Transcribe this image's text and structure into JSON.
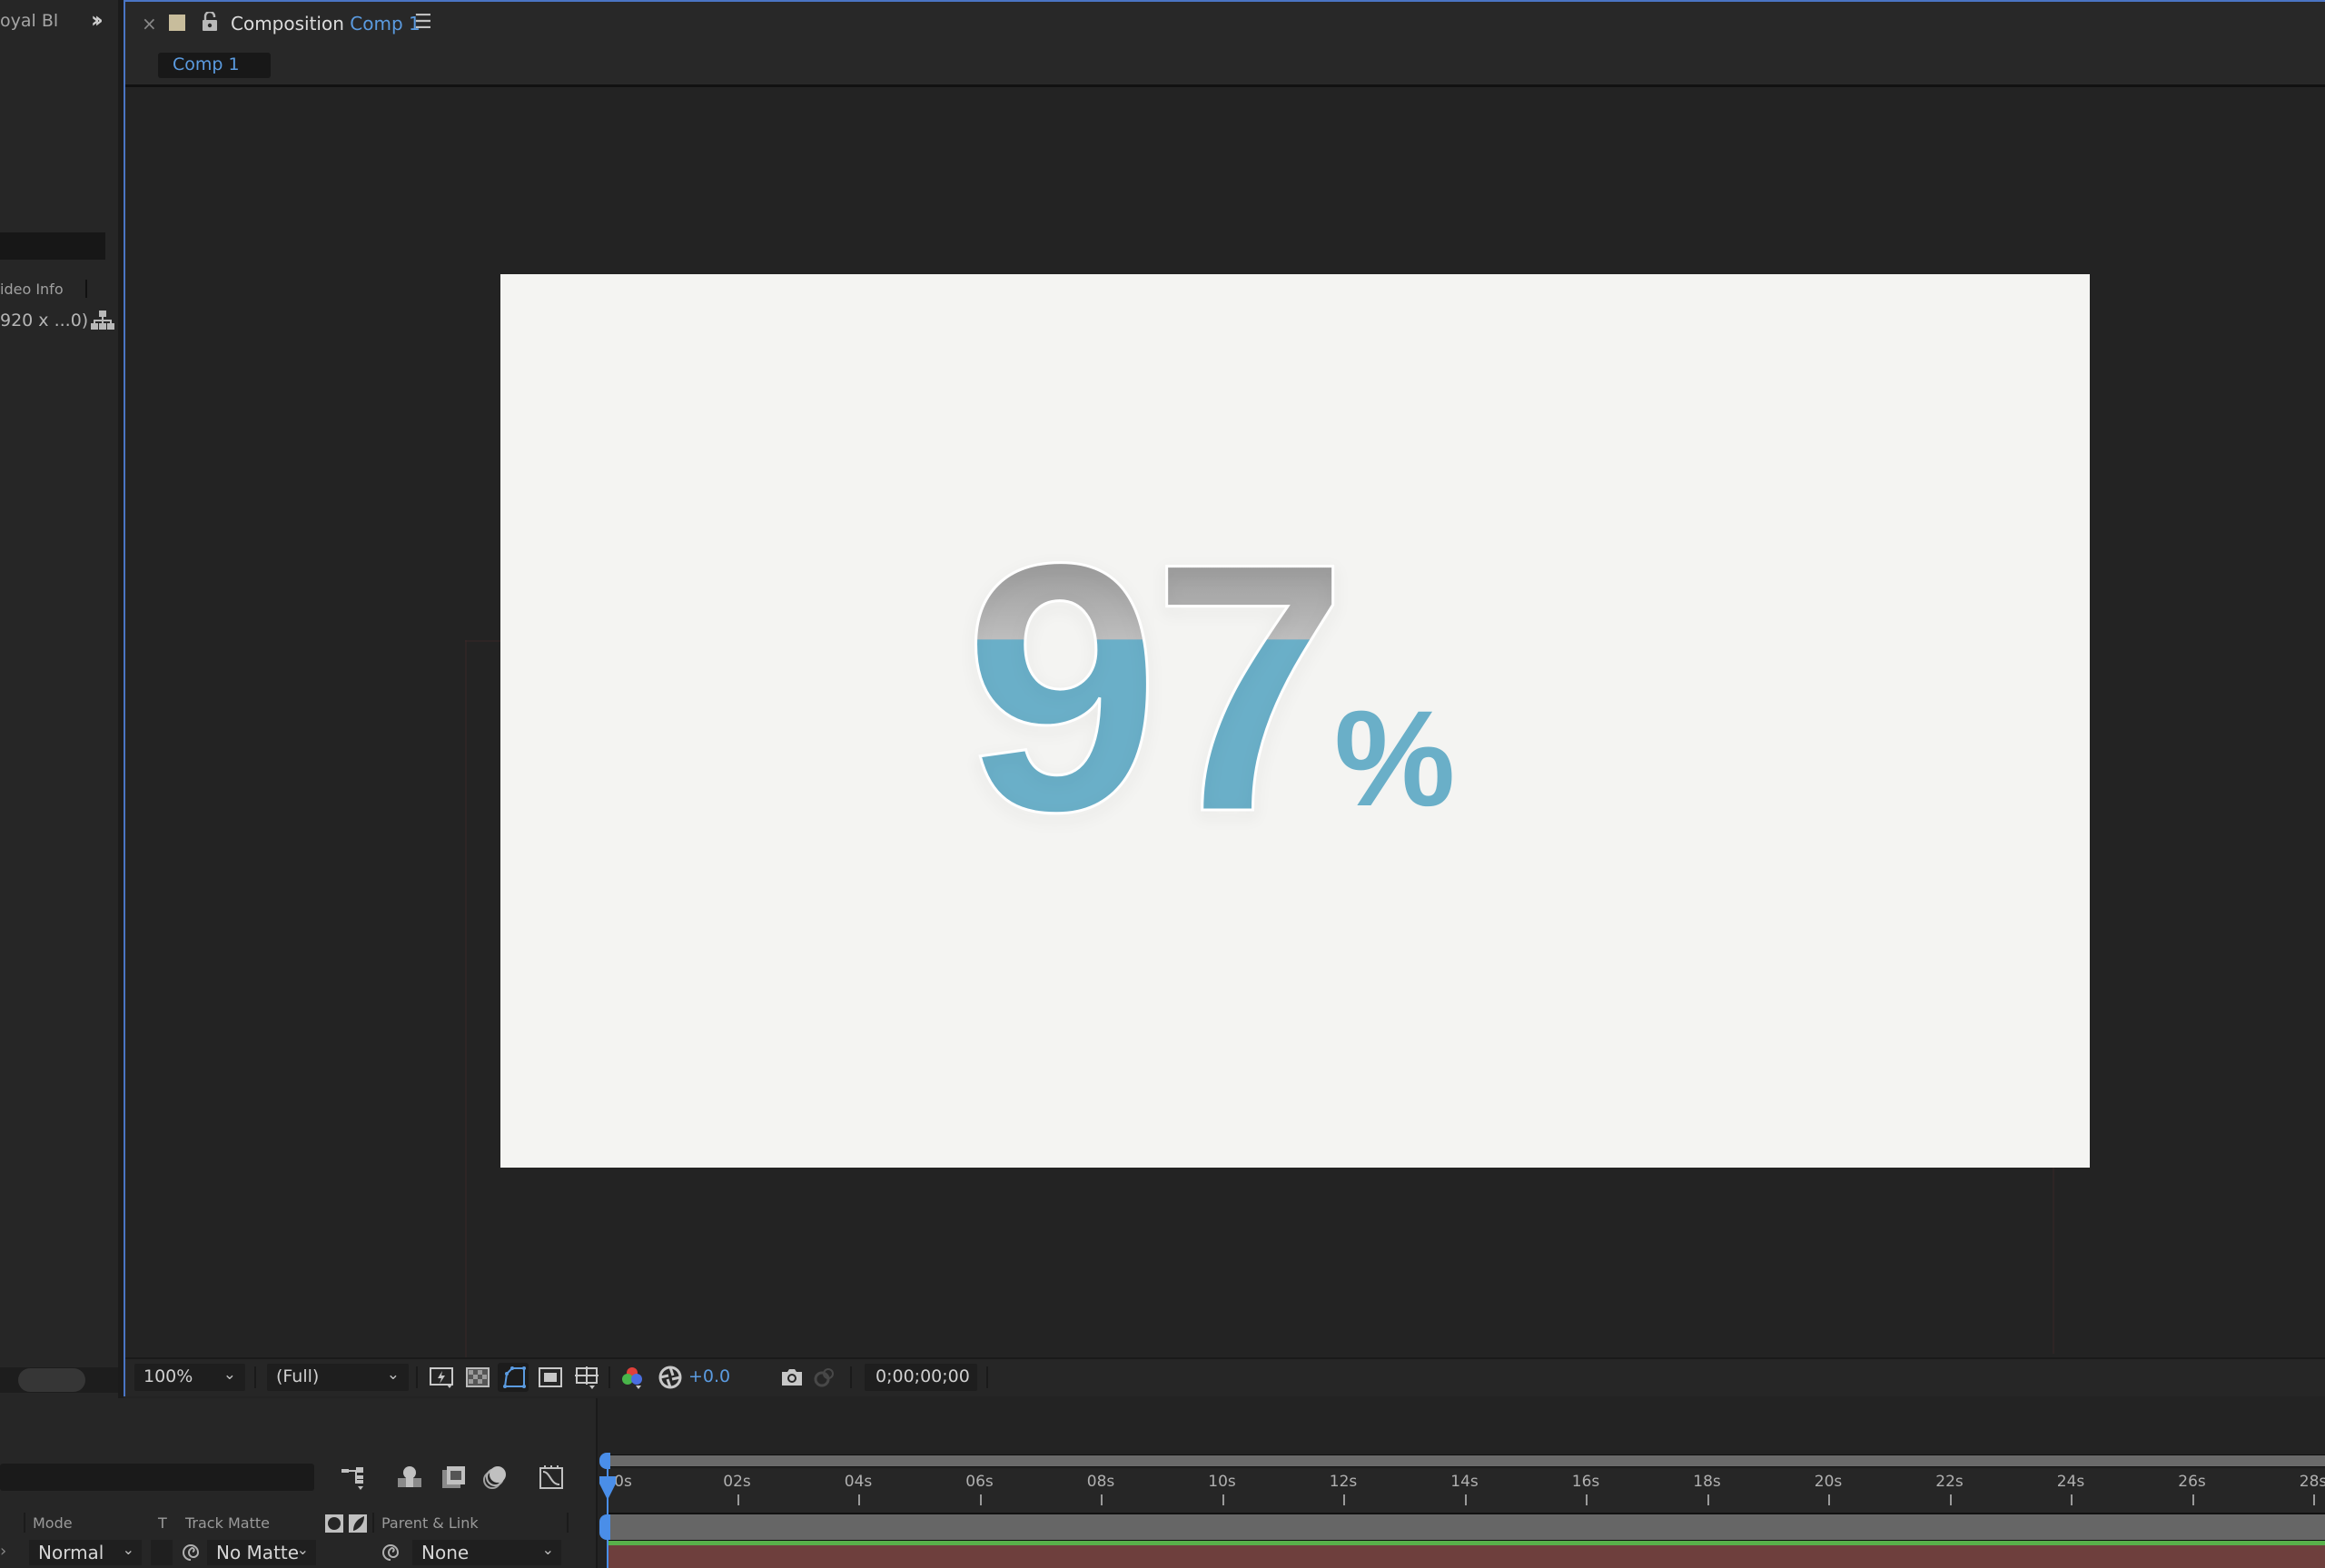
{
  "left_panel": {
    "title_fragment": "oyal Bl",
    "expand_icon": "double-chevron-right-icon",
    "video_info_label": "ideo Info",
    "resolution_text": "920 x ...0)",
    "flowchart_icon": "flowchart-icon"
  },
  "composition_panel": {
    "close_icon": "×",
    "tab_prefix": "Composition",
    "tab_name": "Comp 1",
    "menu_icon": "☰",
    "breadcrumb_chip": "Comp 1",
    "colors": {
      "accent_blue": "#5b9be0",
      "panel_border": "#4a75c4",
      "swatch": "#c8bd9c"
    }
  },
  "canvas": {
    "background": "#f4f4f2",
    "number_text": "97",
    "percent_text": "%",
    "fill_color": "#6aafc8",
    "fill_level_percent": 67
  },
  "viewer_toolbar": {
    "zoom_value": "100%",
    "resolution_value": "(Full)",
    "exposure_value": "+0.0",
    "timecode": "0;00;00;00",
    "icons": [
      "fast-previews-icon",
      "transparency-grid-icon",
      "mask-path-visibility-icon",
      "region-of-interest-icon",
      "grid-guides-icon",
      "channel-icon",
      "reset-exposure-icon",
      "snapshot-icon",
      "show-snapshot-icon"
    ]
  },
  "timeline": {
    "toolbar_icons": [
      "flowchart-icon",
      "draft-3d-icon",
      "frame-blending-icon",
      "motion-blur-icon",
      "graph-editor-icon"
    ],
    "columns": {
      "mode": "Mode",
      "t": "T",
      "track_matte": "Track Matte",
      "parent_link": "Parent & Link"
    },
    "layer": {
      "mode": "Normal",
      "track_matte": "No Matte",
      "parent": "None"
    },
    "ruler_ticks": [
      "0s",
      "02s",
      "04s",
      "06s",
      "08s",
      "10s",
      "12s",
      "14s",
      "16s",
      "18s",
      "20s",
      "22s",
      "24s",
      "26s",
      "28s"
    ],
    "current_time_seconds": 0,
    "colors": {
      "layer_track": "#6e3f3d",
      "label_green": "#58b04a",
      "playhead": "#4a8ee8"
    }
  }
}
